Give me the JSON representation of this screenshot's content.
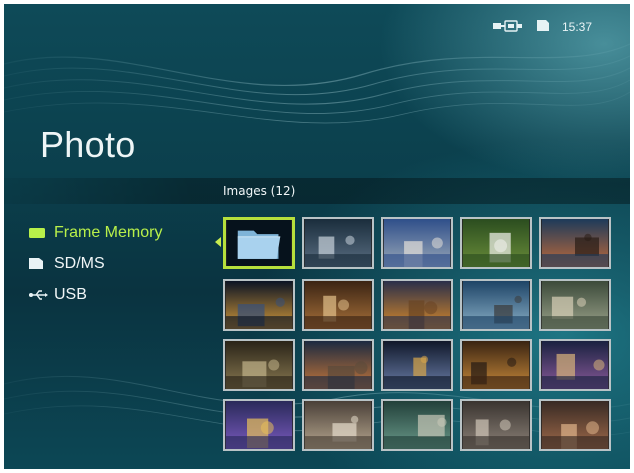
{
  "status": {
    "connection_icon": "usb-connection-icon",
    "card_icon": "memory-card-icon",
    "time": "15:37"
  },
  "page": {
    "title": "Photo"
  },
  "images_header": "Images (12)",
  "sources": [
    {
      "label": "Frame Memory",
      "icon": "frame-memory-icon",
      "selected": true
    },
    {
      "label": "SD/MS",
      "icon": "sd-card-icon",
      "selected": false
    },
    {
      "label": "USB",
      "icon": "usb-icon",
      "selected": false
    }
  ],
  "thumbnails": [
    {
      "kind": "folder",
      "selected": true
    },
    {
      "kind": "photo"
    },
    {
      "kind": "photo"
    },
    {
      "kind": "photo"
    },
    {
      "kind": "photo"
    },
    {
      "kind": "photo"
    },
    {
      "kind": "photo"
    },
    {
      "kind": "photo"
    },
    {
      "kind": "photo"
    },
    {
      "kind": "photo"
    },
    {
      "kind": "photo"
    },
    {
      "kind": "photo"
    },
    {
      "kind": "photo"
    },
    {
      "kind": "photo"
    },
    {
      "kind": "photo"
    },
    {
      "kind": "photo"
    },
    {
      "kind": "photo"
    },
    {
      "kind": "photo"
    },
    {
      "kind": "photo"
    },
    {
      "kind": "photo"
    }
  ],
  "colors": {
    "accent": "#b8f04a",
    "background": "#0b3f4c",
    "thumb_border": "#b9c3c6"
  }
}
